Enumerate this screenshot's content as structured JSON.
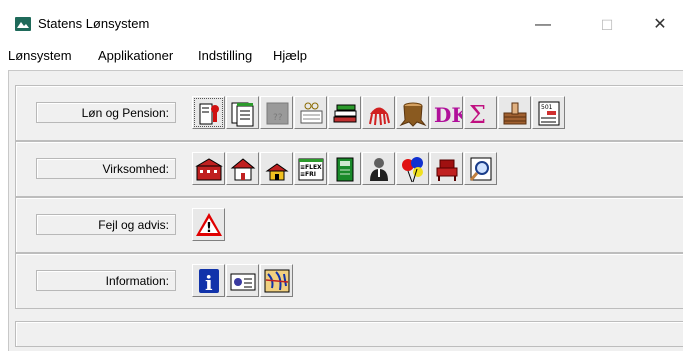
{
  "window": {
    "title": "Statens Lønsystem",
    "minimize_glyph": "—",
    "maximize_glyph": "☐",
    "close_glyph": "✕"
  },
  "menu": [
    "Lønsystem",
    "Applikationer",
    "Indstilling",
    "Hjælp"
  ],
  "rows": [
    {
      "label": "Løn og Pension:",
      "buttons": [
        "person-with-stamp-icon",
        "documents-stack-icon",
        "disabled-document-icon",
        "glasses-ledger-icon",
        "book-stack-icon",
        "red-jellyfish-icon",
        "dk-letters-icon",
        "sigma-sum-icon",
        "hand-on-basket-icon",
        "form-501-icon"
      ]
    },
    {
      "label": "Virksomhed:",
      "buttons": [
        "red-factory-icon",
        "red-house-icon",
        "yellow-house-icon",
        "flex-fri-icon",
        "green-calculator-icon",
        "businessman-icon",
        "balloons-icon",
        "armchair-icon",
        "magnifier-icon"
      ]
    },
    {
      "label": "Fejl og advis:",
      "buttons": [
        "warning-triangle-icon"
      ]
    },
    {
      "label": "Information:",
      "buttons": [
        "info-icon",
        "id-card-icon",
        "map-icon"
      ]
    }
  ],
  "icon_text": {
    "dk": "DK",
    "sigma": "Σ",
    "info": "i",
    "warning": "!",
    "flex_line1": "≡FLEX",
    "flex_line2": "≡FRI",
    "form": "501"
  },
  "colors": {
    "panel": "#f0f0f0",
    "accent_blue": "#1133aa",
    "warning_red": "#e00000",
    "dk_magenta": "#b0109a"
  }
}
